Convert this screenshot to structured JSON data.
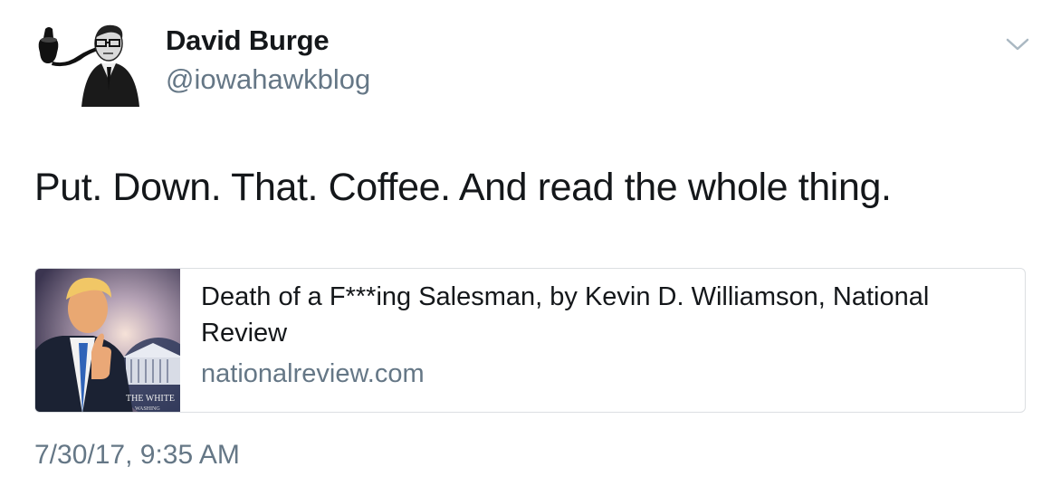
{
  "author": {
    "name": "David Burge",
    "handle": "@iowahawkblog"
  },
  "tweet": {
    "text": "Put. Down. That. Coffee. And read the whole thing."
  },
  "card": {
    "title": "Death of a F***ing Salesman, by Kevin D. Williamson, National Review",
    "domain": "nationalreview.com",
    "thumbnail_caption_line1": "THE WHITE",
    "thumbnail_caption_line2": "WASHING"
  },
  "timestamp": "7/30/17, 9:35 AM",
  "icons": {
    "menu": "chevron-down-icon",
    "avatar": "avatar-pipe-icon"
  },
  "colors": {
    "text_primary": "#14171a",
    "text_secondary": "#657786",
    "card_border": "#dcdfe2"
  }
}
